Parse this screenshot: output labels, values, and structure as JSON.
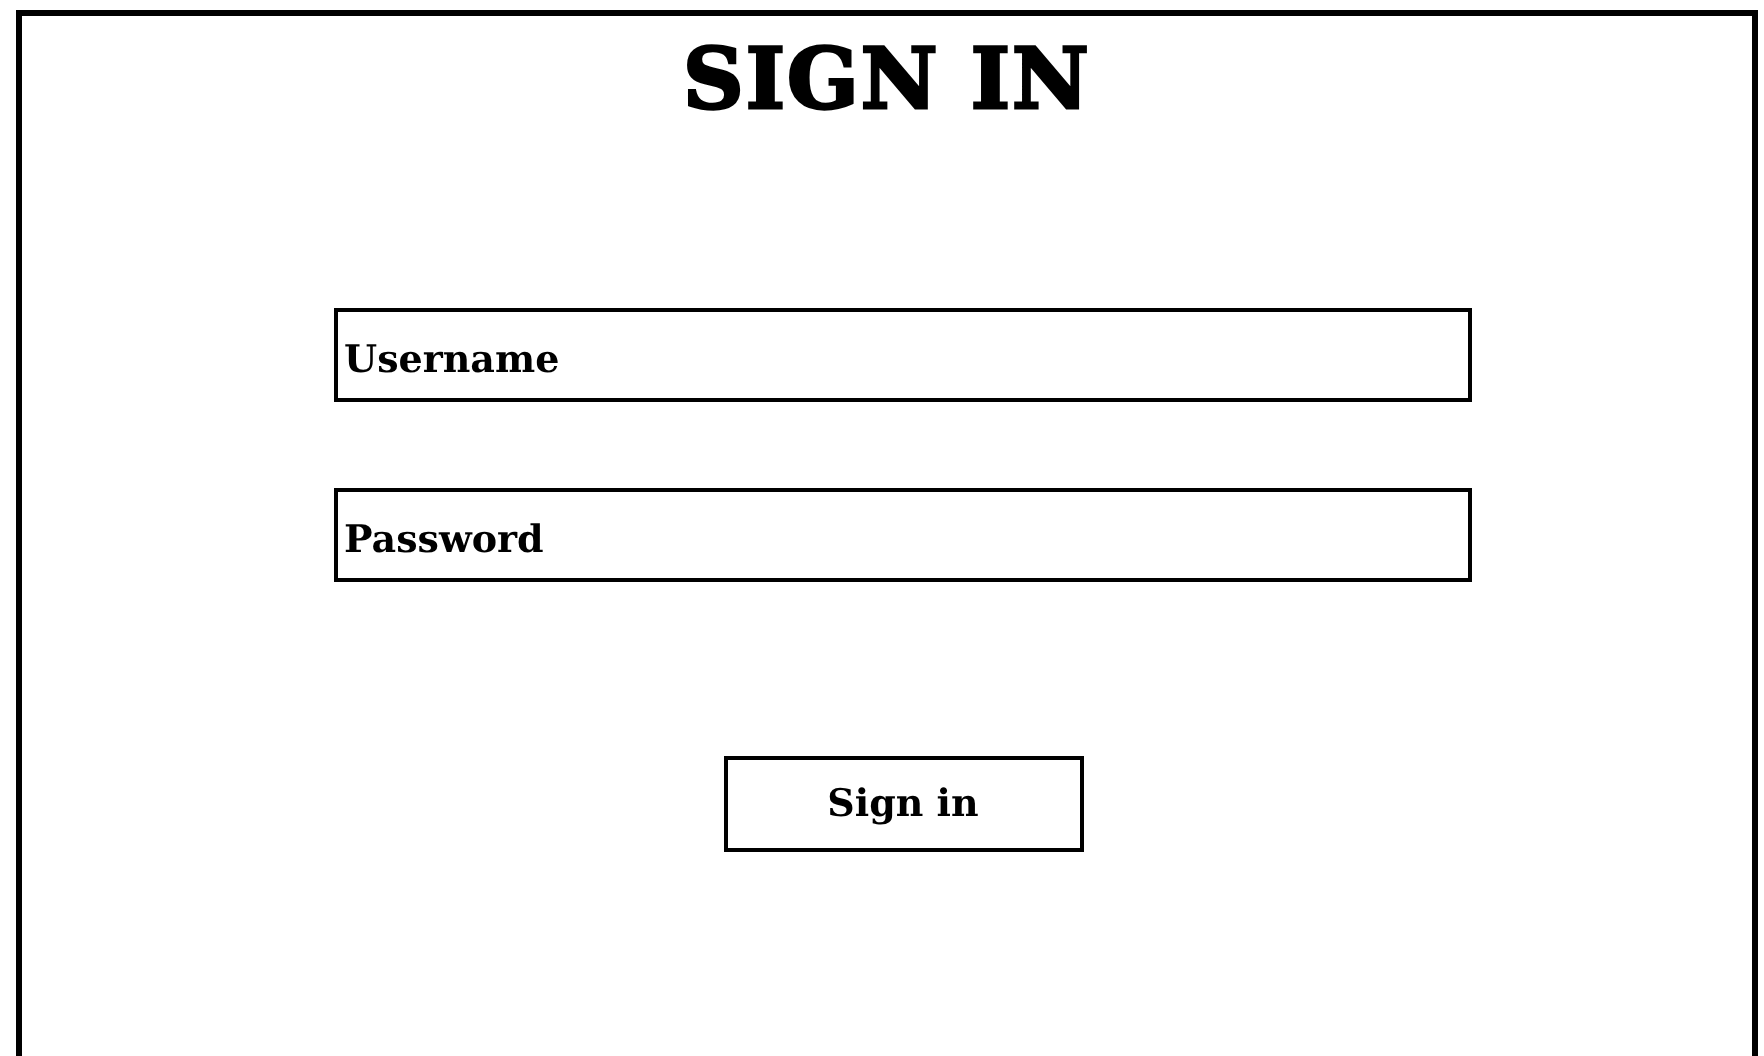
{
  "title": "SIGN IN",
  "fields": [
    {
      "placeholder": "Username"
    },
    {
      "placeholder": "Password"
    }
  ],
  "button": "Sign in"
}
